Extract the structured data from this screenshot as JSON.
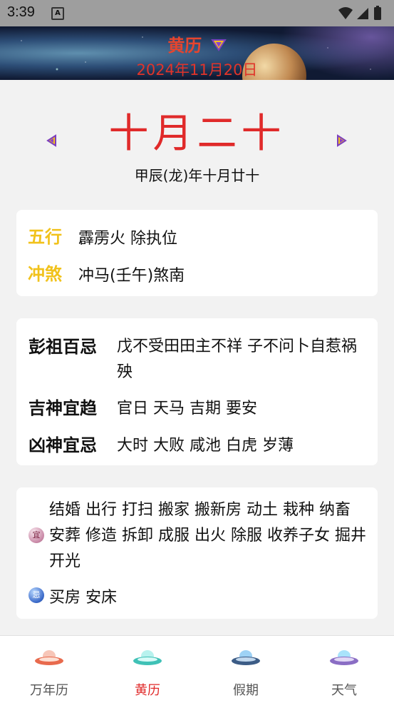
{
  "status": {
    "time": "3:39",
    "notification_icon": "A"
  },
  "header": {
    "title": "黄历",
    "date": "2024年11月20日"
  },
  "lunar": {
    "big": "十月二十",
    "sub": "甲辰(龙)年十月廿十"
  },
  "wuxing": {
    "label": "五行",
    "value": "霹雳火 除执位"
  },
  "chongsha": {
    "label": "冲煞",
    "value": "冲马(壬午)煞南"
  },
  "pengzu": {
    "label": "彭祖百忌",
    "value": "戊不受田田主不祥 子不问卜自惹祸殃"
  },
  "jishen": {
    "label": "吉神宜趋",
    "value": "官日 天马 吉期 要安"
  },
  "xiongshen": {
    "label": "凶神宜忌",
    "value": "大时 大败 咸池 白虎 岁薄"
  },
  "yi": {
    "badge": "宜",
    "value": "结婚 出行 打扫 搬家 搬新房 动土 栽种 纳畜 安葬 修造 拆卸 成服 出火 除服 收养子女 掘井 开光"
  },
  "ji": {
    "badge": "忌",
    "value": "买房 安床"
  },
  "tabs": [
    {
      "label": "万年历",
      "icon": "ufo-red-icon"
    },
    {
      "label": "黄历",
      "icon": "ufo-teal-icon"
    },
    {
      "label": "假期",
      "icon": "ufo-blue-icon"
    },
    {
      "label": "天气",
      "icon": "ufo-purple-icon"
    }
  ],
  "colors": {
    "accent": "#e02a2a",
    "gold": "#f1c21b"
  }
}
